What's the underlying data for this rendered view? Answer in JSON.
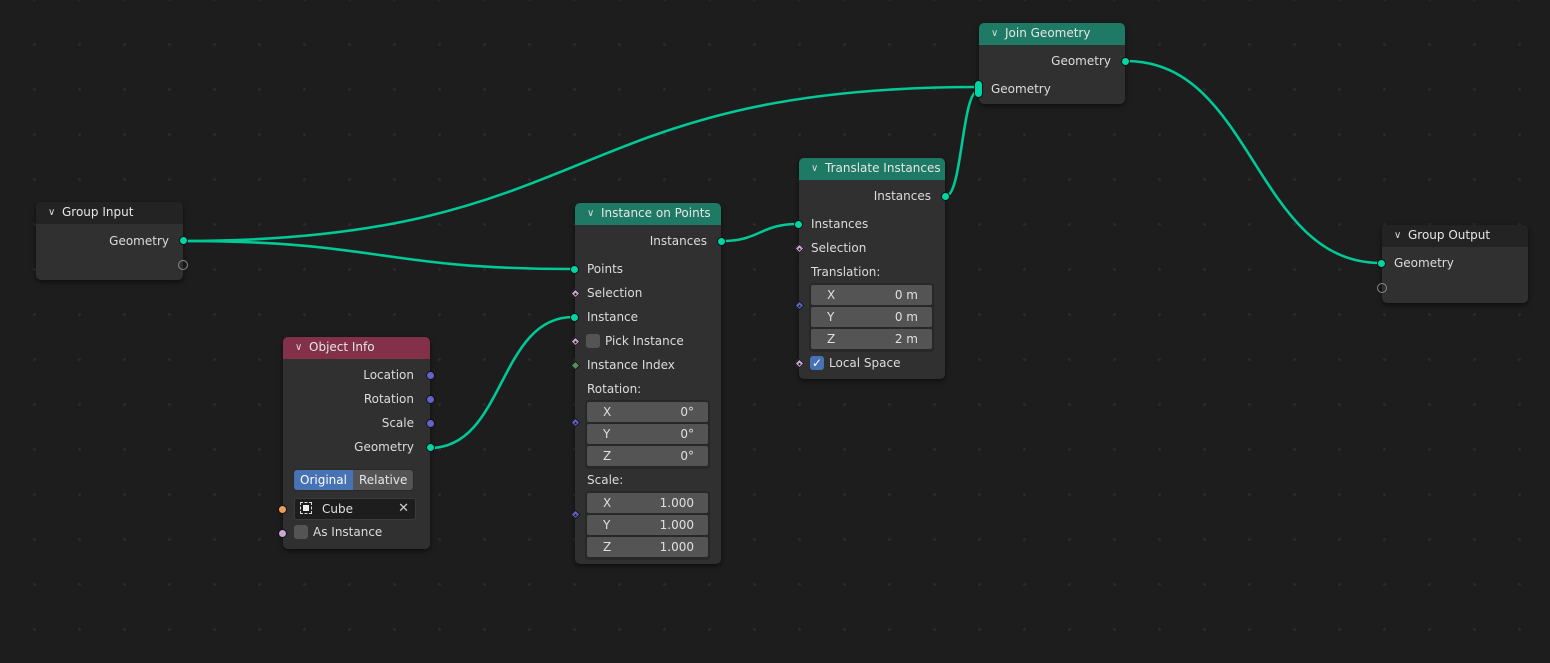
{
  "editor": "Geometry Nodes",
  "colors": {
    "link": "#00c996",
    "geometry_socket": "#00d6a3",
    "vector_socket": "#6363c7",
    "object_socket": "#ed9e5c",
    "boolean_socket": "#cca6d6",
    "integer_socket": "#598c5c",
    "geometry_header": "#1e7a64",
    "input_header": "#83314a",
    "group_header": "#232323",
    "active_button": "#4772b3"
  },
  "nodes": {
    "group_input": {
      "title": "Group Input",
      "outputs": [
        "Geometry"
      ]
    },
    "object_info": {
      "title": "Object Info",
      "outputs": [
        "Location",
        "Rotation",
        "Scale",
        "Geometry"
      ],
      "transform_space": {
        "options": [
          "Original",
          "Relative"
        ],
        "selected": "Original"
      },
      "object": {
        "name": "Cube",
        "icon": "cube-object-icon",
        "clear_icon": "close-icon"
      },
      "as_instance": {
        "label": "As Instance",
        "checked": false
      }
    },
    "instance_on_points": {
      "title": "Instance on Points",
      "outputs": [
        "Instances"
      ],
      "inputs": {
        "points": "Points",
        "selection": "Selection",
        "instance": "Instance",
        "pick_instance": {
          "label": "Pick Instance",
          "checked": false
        },
        "instance_index": "Instance Index",
        "rotation": {
          "label": "Rotation:",
          "x": "0°",
          "y": "0°",
          "z": "0°"
        },
        "scale": {
          "label": "Scale:",
          "x": "1.000",
          "y": "1.000",
          "z": "1.000"
        }
      },
      "axis_labels": [
        "X",
        "Y",
        "Z"
      ]
    },
    "translate_instances": {
      "title": "Translate Instances",
      "outputs": [
        "Instances"
      ],
      "inputs": {
        "instances": "Instances",
        "selection": "Selection",
        "translation": {
          "label": "Translation:",
          "x": "0 m",
          "y": "0 m",
          "z": "2 m"
        },
        "local_space": {
          "label": "Local Space",
          "checked": true
        }
      },
      "axis_labels": [
        "X",
        "Y",
        "Z"
      ]
    },
    "join_geometry": {
      "title": "Join Geometry",
      "outputs": [
        "Geometry"
      ],
      "inputs": [
        "Geometry"
      ]
    },
    "group_output": {
      "title": "Group Output",
      "inputs": [
        "Geometry"
      ]
    }
  },
  "links": [
    {
      "from": "Group Input.Geometry",
      "to": "Instance on Points.Points"
    },
    {
      "from": "Group Input.Geometry",
      "to": "Join Geometry.Geometry"
    },
    {
      "from": "Object Info.Geometry",
      "to": "Instance on Points.Instance"
    },
    {
      "from": "Instance on Points.Instances",
      "to": "Translate Instances.Instances"
    },
    {
      "from": "Translate Instances.Instances",
      "to": "Join Geometry.Geometry"
    },
    {
      "from": "Join Geometry.Geometry",
      "to": "Group Output.Geometry"
    }
  ]
}
